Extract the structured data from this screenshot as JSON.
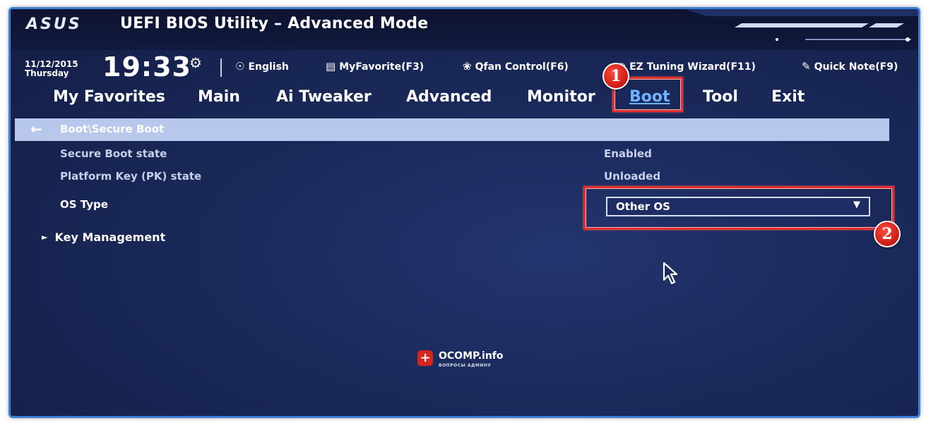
{
  "header": {
    "brand": "ASUS",
    "title": "UEFI BIOS Utility – Advanced Mode"
  },
  "infobar": {
    "date": "11/12/2015",
    "weekday": "Thursday",
    "time": "19:33",
    "language": "English",
    "my_favorite": "MyFavorite(F3)",
    "qfan": "Qfan Control(F6)",
    "ez_tuning": "EZ Tuning Wizard(F11)",
    "quick_note": "Quick Note(F9)"
  },
  "tabs": [
    {
      "label": "My Favorites",
      "active": false
    },
    {
      "label": "Main",
      "active": false
    },
    {
      "label": "Ai Tweaker",
      "active": false
    },
    {
      "label": "Advanced",
      "active": false
    },
    {
      "label": "Monitor",
      "active": false
    },
    {
      "label": "Boot",
      "active": true
    },
    {
      "label": "Tool",
      "active": false
    },
    {
      "label": "Exit",
      "active": false
    }
  ],
  "breadcrumb": {
    "path": "Boot\\Secure Boot"
  },
  "settings": {
    "secure_boot_state": {
      "label": "Secure Boot state",
      "value": "Enabled"
    },
    "pk_state": {
      "label": "Platform Key (PK) state",
      "value": "Unloaded"
    },
    "os_type": {
      "label": "OS Type",
      "selected": "Other OS"
    },
    "key_management": {
      "label": "Key Management"
    }
  },
  "annotations": {
    "marker_1": "1",
    "marker_2": "2",
    "accent_color": "#e03030"
  },
  "watermark": {
    "name": "OCOMP.info",
    "tagline": "ВОПРОСЫ АДМИНУ"
  },
  "colors": {
    "background": "#1b2a5c",
    "active_tab": "#6fb2ff",
    "breadcrumb_bar": "#b8c7ec"
  }
}
